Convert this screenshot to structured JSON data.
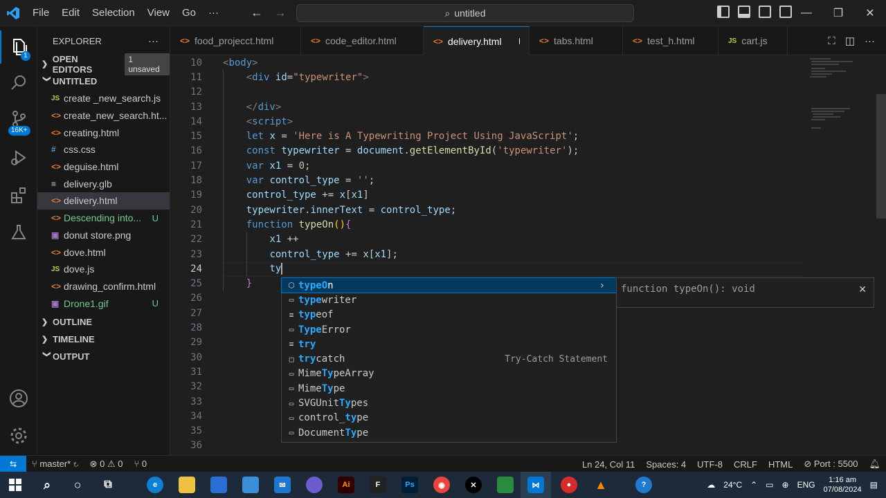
{
  "titlebar": {
    "menu": [
      "File",
      "Edit",
      "Selection",
      "View",
      "Go",
      "···"
    ],
    "search_text": "untitled"
  },
  "activity": {
    "explorer_badge": "1",
    "scm_badge": "16K+"
  },
  "sidebar": {
    "title": "EXPLORER",
    "more": "···",
    "open_editors": "OPEN EDITORS",
    "unsaved_badge": "1 unsaved",
    "folder": "UNTITLED",
    "files": [
      {
        "name": "create _new_search.js",
        "icon": "JS",
        "type": "js",
        "git": ""
      },
      {
        "name": "create_new_search.ht...",
        "icon": "<>",
        "type": "html",
        "git": ""
      },
      {
        "name": "creating.html",
        "icon": "<>",
        "type": "html",
        "git": ""
      },
      {
        "name": "css.css",
        "icon": "#",
        "type": "css",
        "git": ""
      },
      {
        "name": "deguise.html",
        "icon": "<>",
        "type": "html",
        "git": ""
      },
      {
        "name": "delivery.glb",
        "icon": "≡",
        "type": "glb",
        "git": ""
      },
      {
        "name": "delivery.html",
        "icon": "<>",
        "type": "html",
        "git": ""
      },
      {
        "name": "Descending into...",
        "icon": "<>",
        "type": "html",
        "git": "U"
      },
      {
        "name": "donut store.png",
        "icon": "▣",
        "type": "img",
        "git": ""
      },
      {
        "name": "dove.html",
        "icon": "<>",
        "type": "html",
        "git": ""
      },
      {
        "name": "dove.js",
        "icon": "JS",
        "type": "js",
        "git": ""
      },
      {
        "name": "drawing_confirm.html",
        "icon": "<>",
        "type": "html",
        "git": ""
      },
      {
        "name": "Drone1.gif",
        "icon": "▣",
        "type": "img",
        "git": "U"
      }
    ],
    "outline": "OUTLINE",
    "timeline": "TIMELINE",
    "output": "OUTPUT"
  },
  "tabs": [
    {
      "label": "food_projecct.html",
      "icon": "<>"
    },
    {
      "label": "code_editor.html",
      "icon": "<>"
    },
    {
      "label": "delivery.html",
      "icon": "<>"
    },
    {
      "label": "tabs.html",
      "icon": "<>"
    },
    {
      "label": "test_h.html",
      "icon": "<>"
    },
    {
      "label": "cart.js",
      "icon": "JS"
    }
  ],
  "editor": {
    "line_numbers": [
      "10",
      "11",
      "12",
      "13",
      "14",
      "15",
      "16",
      "17",
      "18",
      "19",
      "20",
      "21",
      "22",
      "23",
      "24",
      "25",
      "26",
      "27",
      "28",
      "29",
      "30",
      "31",
      "32",
      "33",
      "34",
      "35",
      "36"
    ],
    "current_line": "24"
  },
  "suggest": {
    "items": [
      {
        "pre": "",
        "hl": "typeO",
        "post": "n",
        "icon": "⬡",
        "detail": ""
      },
      {
        "pre": "",
        "hl": "type",
        "post": "writer",
        "icon": "▭",
        "detail": ""
      },
      {
        "pre": "",
        "hl": "typ",
        "post": "eof",
        "icon": "≡",
        "detail": ""
      },
      {
        "pre": "",
        "hl": "Type",
        "post": "Error",
        "icon": "▭",
        "detail": ""
      },
      {
        "pre": "",
        "hl": "try",
        "post": "",
        "icon": "≡",
        "detail": ""
      },
      {
        "pre": "",
        "hl": "try",
        "post": "catch",
        "icon": "□",
        "detail": "Try-Catch Statement"
      },
      {
        "pre": "Mime",
        "hl": "Ty",
        "post": "peArray",
        "icon": "▭",
        "detail": ""
      },
      {
        "pre": "Mime",
        "hl": "Ty",
        "post": "pe",
        "icon": "▭",
        "detail": ""
      },
      {
        "pre": "SVGUnit",
        "hl": "Ty",
        "post": "pes",
        "icon": "▭",
        "detail": ""
      },
      {
        "pre": "control_",
        "hl": "ty",
        "post": "pe",
        "icon": "▭",
        "detail": ""
      },
      {
        "pre": "Document",
        "hl": "Ty",
        "post": "pe",
        "icon": "▭",
        "detail": ""
      }
    ],
    "detail_text": "function typeOn(): void"
  },
  "statusbar": {
    "branch": "master*",
    "problems": "⊗ 0 ⚠ 0",
    "ports_count": "⑂ 0",
    "position": "Ln 24, Col 11",
    "spaces": "Spaces: 4",
    "encoding": "UTF-8",
    "eol": "CRLF",
    "language": "HTML",
    "port": "Port : 5500"
  },
  "taskbar": {
    "temperature": "24°C",
    "lang": "ENG",
    "time": "1:16 am",
    "date": "07/08/2024"
  },
  "colors": {
    "accent": "#0078d4",
    "editor_bg": "#1f1f1f",
    "sidebar_bg": "#181818"
  }
}
